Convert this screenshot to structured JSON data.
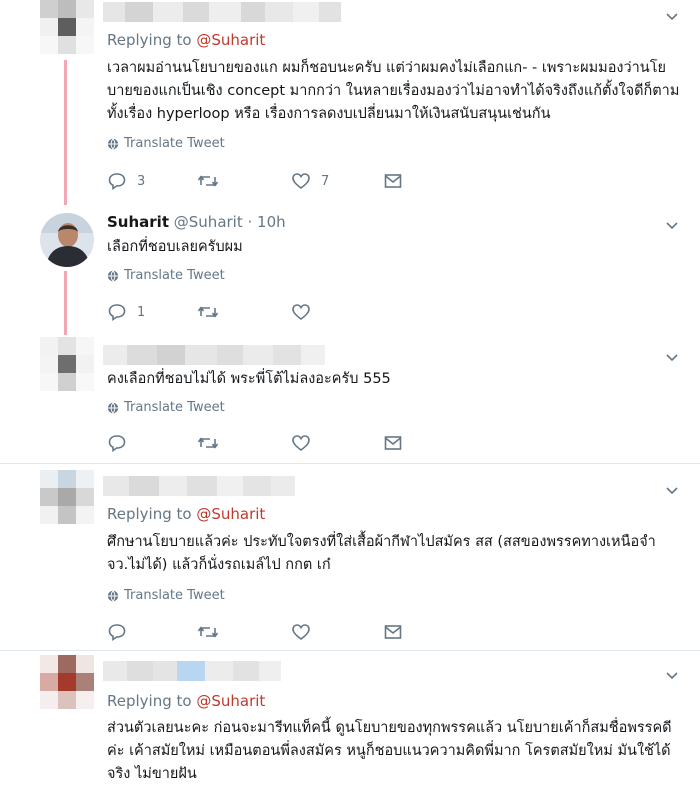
{
  "colors": {
    "text": "#14171a",
    "muted": "#657786",
    "mention": "#c0392b",
    "thread": "#f2a8b4",
    "divider": "#e1e8ed"
  },
  "tweets": [
    {
      "replying_label": "Replying to",
      "replying_to": "@Suharit",
      "text": "เวลาผมอ่านนโยบายของแก ผมก็ชอบนะครับ แต่ว่าผมคงไม่เลือกแก- - เพราะผมมองว่านโยบายของแกเป็นเชิง concept มากกว่า ในหลายเรื่องมองว่าไม่อาจทำได้จริงถึงแก้ตั้งใจดีก็ตามทั้งเรื่อง hyperloop หรือ เรื่องการลดงบเปลี่ยนมาให้เงินสนับสนุนเช่นกัน",
      "translate": "Translate Tweet",
      "replies": "3",
      "retweets": "",
      "likes": "7"
    },
    {
      "name": "Suharit",
      "handle": "@Suharit · 10h",
      "text": "เลือกที่ชอบเลยครับผม",
      "translate": "Translate Tweet",
      "replies": "1",
      "retweets": "",
      "likes": ""
    },
    {
      "text": "คงเลือกที่ชอบไม่ได้ พระพี่โต้ไม่ลงอะครับ 555",
      "translate": "Translate Tweet",
      "replies": "",
      "retweets": "",
      "likes": ""
    },
    {
      "replying_label": "Replying to",
      "replying_to": "@Suharit",
      "text": "ศึกษานโยบายแล้วค่ะ ประทับใจตรงที่ใส่เสื้อผ้ากีฬาไปสมัคร สส (สสของพรรคทางเหนือจำ จว.ไม่ได้) แล้วก็นั่งรถเมล์ไป กกต เก๋",
      "translate": "Translate Tweet",
      "replies": "",
      "retweets": "",
      "likes": ""
    },
    {
      "replying_label": "Replying to",
      "replying_to": "@Suharit",
      "text": "ส่วนตัวเลยนะคะ ก่อนจะมารีทแท็คนี้ ดูนโยบายของทุกพรรคแล้ว นโยบายเค้าก็สมชื่อพรรคดีค่ะ เค้าสมัยใหม่ เหมือนตอนพี่ลงสมัคร หนูก็ชอบแนวความคิดพี่มาก โครตสมัยใหม่ มันใช้ได้จริง ไม่ขายฝัน"
    }
  ]
}
